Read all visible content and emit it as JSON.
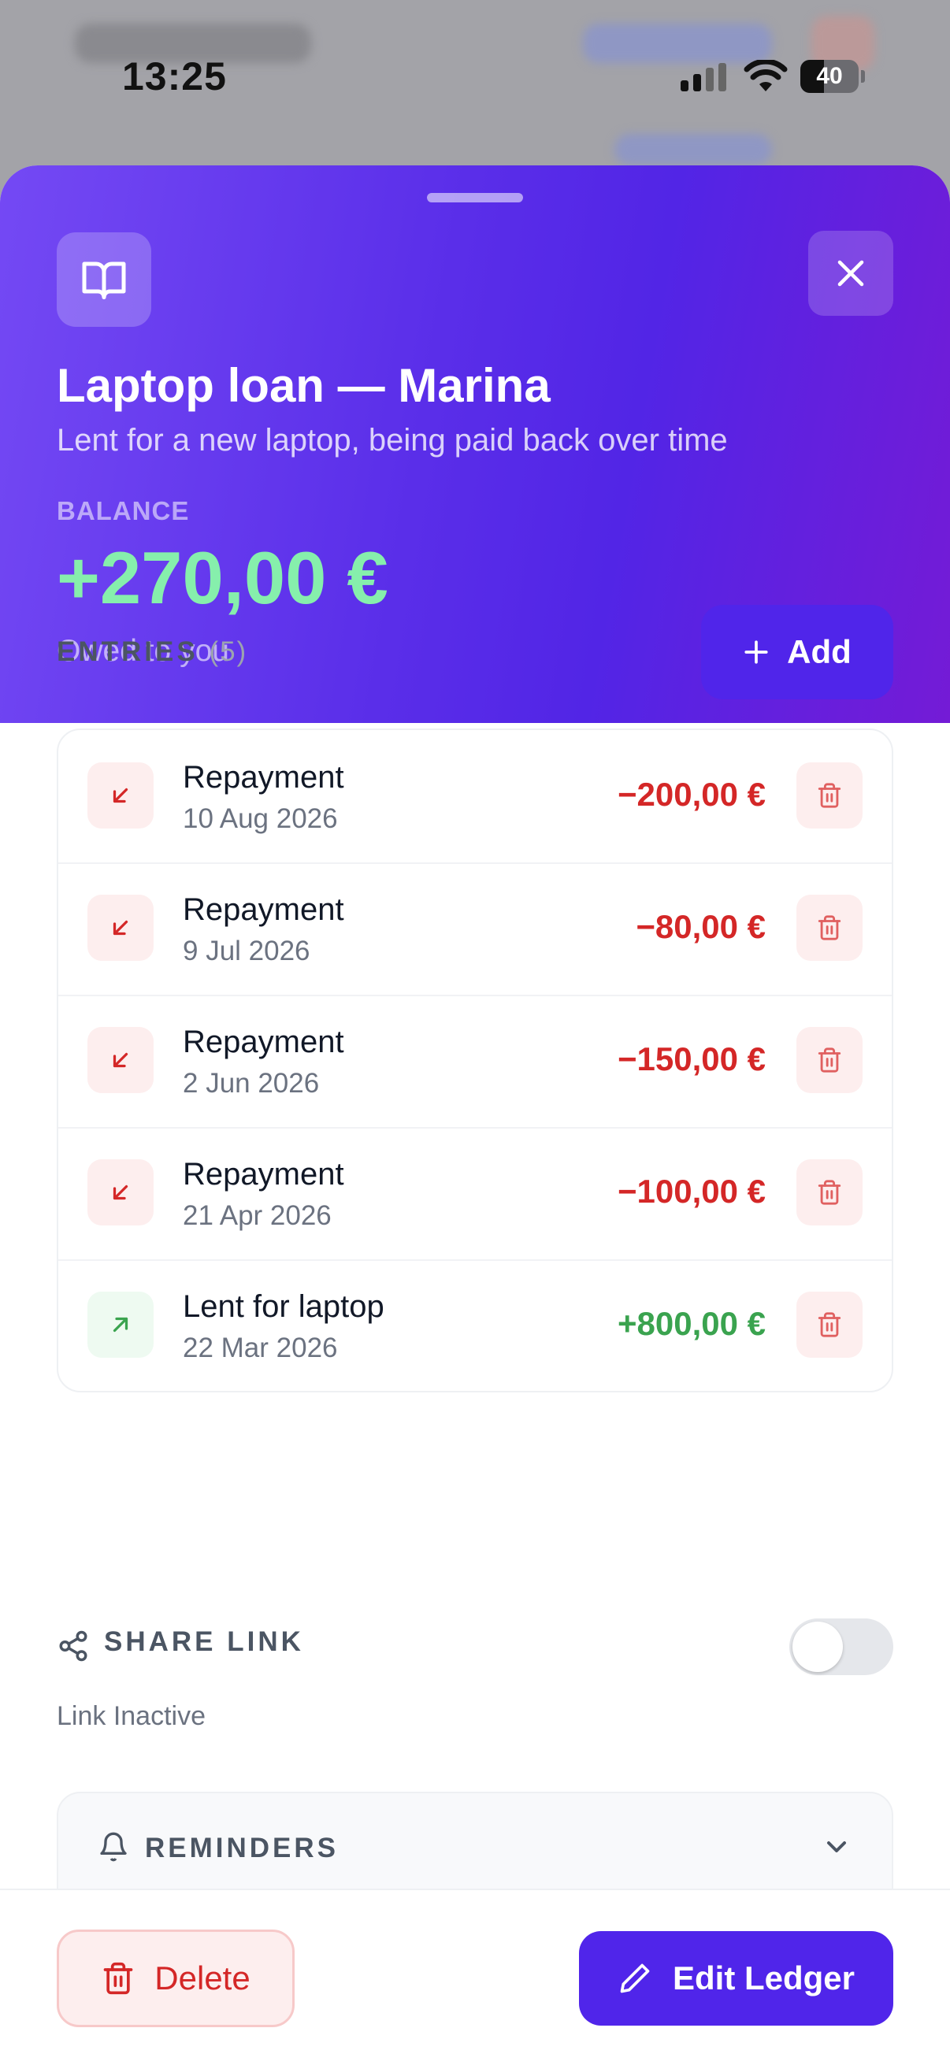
{
  "status_bar": {
    "time": "13:25",
    "battery_level": "40",
    "battery_fraction": 0.4
  },
  "ledger": {
    "title": "Laptop loan — Marina",
    "subtitle": "Lent for a new laptop, being paid back over time",
    "balance_label": "BALANCE",
    "balance_value": "+270,00 €",
    "balance_note": "Owed to you",
    "icon": "book-open-icon",
    "close_icon": "close-icon"
  },
  "entries": {
    "heading": "ENTRIES",
    "count": "(5)",
    "add_label": "Add",
    "items": [
      {
        "label": "Repayment",
        "date": "10 Aug 2026",
        "amount": "−200,00 €",
        "direction": "out"
      },
      {
        "label": "Repayment",
        "date": "9 Jul 2026",
        "amount": "−80,00 €",
        "direction": "out"
      },
      {
        "label": "Repayment",
        "date": "2 Jun 2026",
        "amount": "−150,00 €",
        "direction": "out"
      },
      {
        "label": "Repayment",
        "date": "21 Apr 2026",
        "amount": "−100,00 €",
        "direction": "out"
      },
      {
        "label": "Lent for laptop",
        "date": "22 Mar 2026",
        "amount": "+800,00 €",
        "direction": "in"
      }
    ]
  },
  "share": {
    "label": "SHARE LINK",
    "status": "Link Inactive",
    "enabled": false
  },
  "reminders": {
    "label": "REMINDERS"
  },
  "footer": {
    "delete_label": "Delete",
    "edit_label": "Edit Ledger"
  },
  "colors": {
    "accent": "#5025ea",
    "positive": "#3aa34f",
    "negative": "#d42727",
    "balance": "#86efac"
  }
}
